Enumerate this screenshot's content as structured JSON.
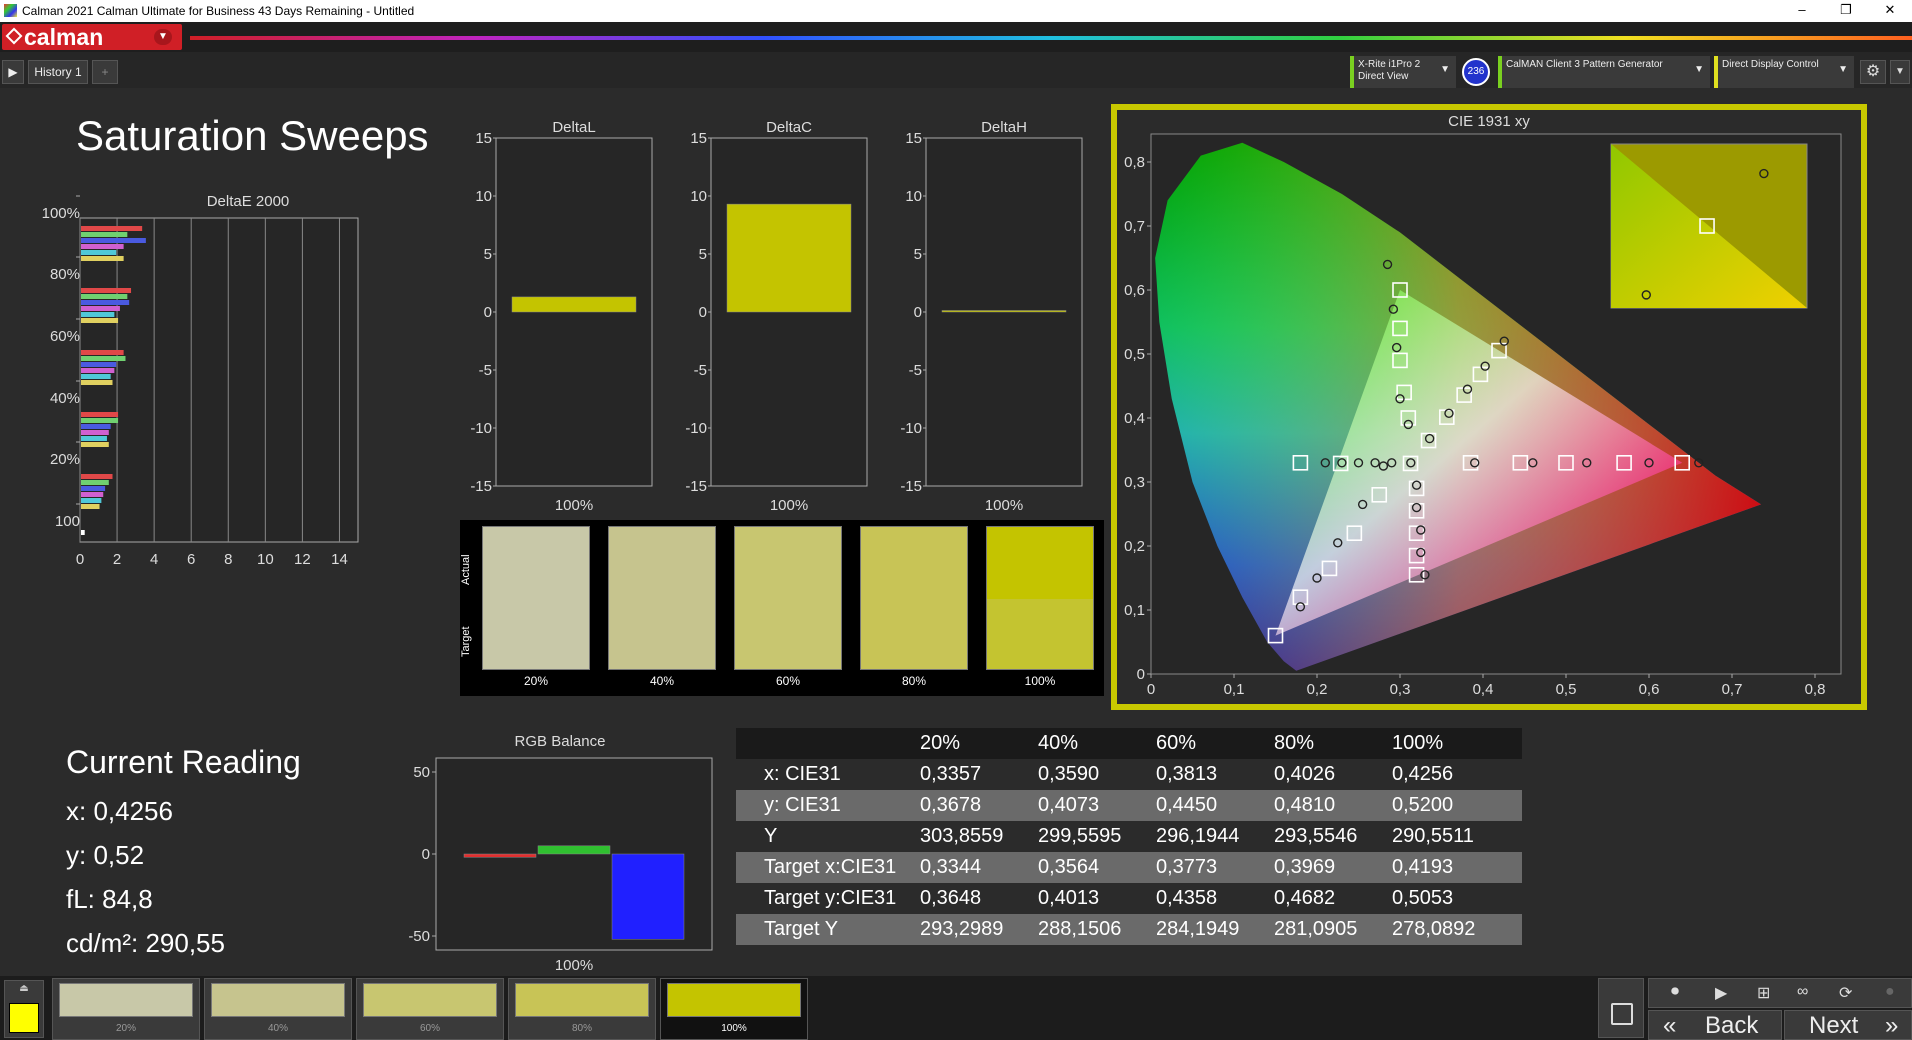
{
  "window": {
    "title": "Calman 2021 Calman Ultimate for Business 43 Days Remaining  - Untitled",
    "min": "–",
    "restore": "❐",
    "close": "✕"
  },
  "brand": {
    "name": "calman"
  },
  "tabs": {
    "play": "▶",
    "history": "History 1",
    "add": "+"
  },
  "devices": {
    "meter": "X-Rite i1Pro 2\nDirect View",
    "meter_badge": "236",
    "generator": "CalMAN Client 3 Pattern Generator",
    "display": "Direct Display Control"
  },
  "page": {
    "title": "Saturation Sweeps"
  },
  "deltae": {
    "title": "DeltaE 2000",
    "yticks": [
      "100%",
      "80%",
      "60%",
      "40%",
      "20%",
      "100"
    ],
    "xticks": [
      "0",
      "2",
      "4",
      "6",
      "8",
      "10",
      "12",
      "14"
    ],
    "groups": [
      {
        "label": "100%",
        "values": [
          3.3,
          2.5,
          3.5,
          2.3,
          1.9,
          2.3
        ]
      },
      {
        "label": "80%",
        "values": [
          2.7,
          2.5,
          2.6,
          2.1,
          1.8,
          2.0
        ]
      },
      {
        "label": "60%",
        "values": [
          2.3,
          2.4,
          1.9,
          1.8,
          1.6,
          1.7
        ]
      },
      {
        "label": "40%",
        "values": [
          2.0,
          2.0,
          1.6,
          1.5,
          1.4,
          1.5
        ]
      },
      {
        "label": "20%",
        "values": [
          1.7,
          1.5,
          1.3,
          1.2,
          1.1,
          1.0
        ]
      }
    ],
    "colors": [
      "#e04848",
      "#70d070",
      "#4a5ae0",
      "#d060d0",
      "#50c8d8",
      "#e0d060"
    ],
    "extra": 0.2
  },
  "deltas": [
    {
      "title": "DeltaL",
      "value": 1.3,
      "xlabel": "100%"
    },
    {
      "title": "DeltaC",
      "value": 9.3,
      "xlabel": "100%"
    },
    {
      "title": "DeltaH",
      "value": 0.05,
      "xlabel": "100%"
    }
  ],
  "delta_yticks": [
    "15",
    "10",
    "5",
    "0",
    "-5",
    "-10",
    "-15"
  ],
  "swatches": {
    "actual_label": "Actual",
    "target_label": "Target",
    "items": [
      {
        "label": "20%",
        "actual": "#c8c8a8",
        "target": "#c8c8a8"
      },
      {
        "label": "40%",
        "actual": "#c6c48e",
        "target": "#c6c48e"
      },
      {
        "label": "60%",
        "actual": "#c8c670",
        "target": "#c8c670"
      },
      {
        "label": "80%",
        "actual": "#c8c456",
        "target": "#c8c456"
      },
      {
        "label": "100%",
        "actual": "#c4c400",
        "target": "#c4c430"
      }
    ]
  },
  "cie": {
    "title": "CIE 1931 xy",
    "xticks": [
      "0",
      "0,1",
      "0,2",
      "0,3",
      "0,4",
      "0,5",
      "0,6",
      "0,7",
      "0,8"
    ],
    "yticks": [
      "0",
      "0,1",
      "0,2",
      "0,3",
      "0,4",
      "0,5",
      "0,6",
      "0,7",
      "0,8"
    ],
    "targets": [
      [
        0.64,
        0.33
      ],
      [
        0.57,
        0.33
      ],
      [
        0.5,
        0.33
      ],
      [
        0.445,
        0.33
      ],
      [
        0.385,
        0.33
      ],
      [
        0.3,
        0.6
      ],
      [
        0.3,
        0.54
      ],
      [
        0.3,
        0.49
      ],
      [
        0.305,
        0.44
      ],
      [
        0.31,
        0.4
      ],
      [
        0.15,
        0.06
      ],
      [
        0.18,
        0.12
      ],
      [
        0.215,
        0.165
      ],
      [
        0.245,
        0.22
      ],
      [
        0.275,
        0.28
      ],
      [
        0.4193,
        0.5053
      ],
      [
        0.3969,
        0.4682
      ],
      [
        0.3773,
        0.4358
      ],
      [
        0.3564,
        0.4013
      ],
      [
        0.3344,
        0.3648
      ],
      [
        0.3127,
        0.329
      ],
      [
        0.2285,
        0.329
      ],
      [
        0.32,
        0.29
      ],
      [
        0.32,
        0.255
      ],
      [
        0.32,
        0.22
      ],
      [
        0.32,
        0.185
      ],
      [
        0.32,
        0.155
      ],
      [
        0.18,
        0.33
      ]
    ],
    "measured": [
      [
        0.66,
        0.33
      ],
      [
        0.6,
        0.33
      ],
      [
        0.525,
        0.33
      ],
      [
        0.46,
        0.33
      ],
      [
        0.39,
        0.33
      ],
      [
        0.285,
        0.64
      ],
      [
        0.292,
        0.57
      ],
      [
        0.296,
        0.51
      ],
      [
        0.3,
        0.43
      ],
      [
        0.31,
        0.39
      ],
      [
        0.18,
        0.105
      ],
      [
        0.2,
        0.15
      ],
      [
        0.225,
        0.205
      ],
      [
        0.255,
        0.265
      ],
      [
        0.28,
        0.325
      ],
      [
        0.4256,
        0.52
      ],
      [
        0.4026,
        0.481
      ],
      [
        0.3813,
        0.445
      ],
      [
        0.359,
        0.4073
      ],
      [
        0.3357,
        0.3678
      ],
      [
        0.313,
        0.33
      ],
      [
        0.21,
        0.33
      ],
      [
        0.23,
        0.33
      ],
      [
        0.25,
        0.33
      ],
      [
        0.27,
        0.33
      ],
      [
        0.29,
        0.33
      ],
      [
        0.32,
        0.295
      ],
      [
        0.32,
        0.26
      ],
      [
        0.325,
        0.225
      ],
      [
        0.325,
        0.19
      ],
      [
        0.33,
        0.155
      ]
    ],
    "inset_measured": [
      [
        0.78,
        0.18
      ],
      [
        0.18,
        0.92
      ]
    ],
    "inset_target": [
      [
        0.49,
        0.5
      ]
    ]
  },
  "current": {
    "title": "Current Reading",
    "x": "x: 0,4256",
    "y": "y: 0,52",
    "fl": "fL: 84,8",
    "cdm": "cd/m²: 290,55"
  },
  "rgb": {
    "title": "RGB Balance",
    "yticks": [
      "50",
      "0",
      "-50"
    ],
    "xlabel": "100%",
    "values": [
      {
        "color": "#e03030",
        "value": -2
      },
      {
        "color": "#30c030",
        "value": 5
      },
      {
        "color": "#2020ff",
        "value": -52
      }
    ]
  },
  "table": {
    "headers": [
      "",
      "20%",
      "40%",
      "60%",
      "80%",
      "100%"
    ],
    "rows": [
      [
        "x: CIE31",
        "0,3357",
        "0,3590",
        "0,3813",
        "0,4026",
        "0,4256"
      ],
      [
        "y: CIE31",
        "0,3678",
        "0,4073",
        "0,4450",
        "0,4810",
        "0,5200"
      ],
      [
        "Y",
        "303,8559",
        "299,5595",
        "296,1944",
        "293,5546",
        "290,5511"
      ],
      [
        "Target x:CIE31",
        "0,3344",
        "0,3564",
        "0,3773",
        "0,3969",
        "0,4193"
      ],
      [
        "Target y:CIE31",
        "0,3648",
        "0,4013",
        "0,4358",
        "0,4682",
        "0,5053"
      ],
      [
        "Target Y",
        "293,2989",
        "288,1506",
        "284,1949",
        "281,0905",
        "278,0892"
      ]
    ]
  },
  "bottom": {
    "patches": [
      {
        "label": "20%",
        "color": "#c8c8a8"
      },
      {
        "label": "40%",
        "color": "#c6c48e"
      },
      {
        "label": "60%",
        "color": "#c8c670"
      },
      {
        "label": "80%",
        "color": "#c8c456"
      },
      {
        "label": "100%",
        "color": "#c4c400"
      }
    ],
    "back": "Back",
    "next": "Next",
    "current_color": "#ffff00"
  }
}
